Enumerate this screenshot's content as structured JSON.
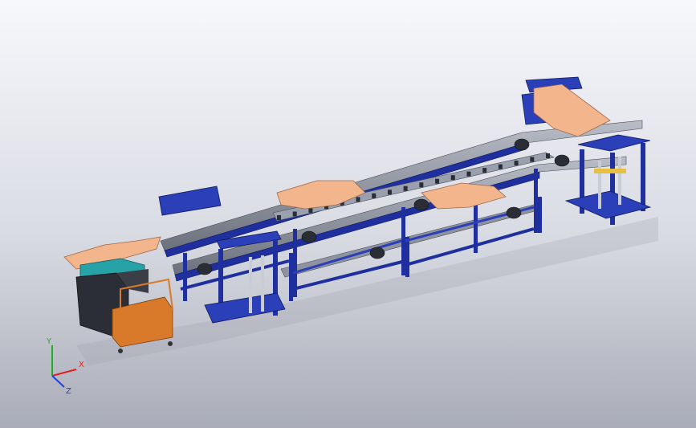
{
  "viewport": {
    "background_top": "#f7f8fb",
    "background_bottom": "#a9acb8"
  },
  "model": {
    "frame_color": "#1f2f9e",
    "frame_dark": "#101a5c",
    "rail_color": "#8a8f9c",
    "part_color": "#f2b58c",
    "cart_color": "#d97a2a",
    "fixture_color": "#27a3a8",
    "motor_color": "#2a2d35"
  },
  "triad": {
    "x_label": "X",
    "y_label": "Y",
    "z_label": "Z",
    "x_color": "#e02020",
    "y_color": "#20b020",
    "z_color": "#2040e0"
  }
}
